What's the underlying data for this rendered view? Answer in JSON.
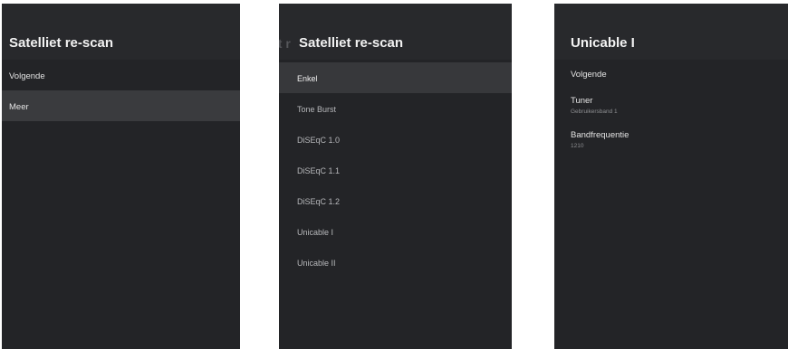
{
  "panel1": {
    "title": "Satelliet re-scan",
    "items": [
      {
        "label": "Volgende"
      },
      {
        "label": "Meer",
        "selected": true
      }
    ]
  },
  "panel2": {
    "ghost_title": "et r",
    "title": "Satelliet re-scan",
    "items": [
      {
        "label": "Enkel",
        "selected": true
      },
      {
        "label": "Tone Burst"
      },
      {
        "label": "DiSEqC 1.0"
      },
      {
        "label": "DiSEqC 1.1"
      },
      {
        "label": "DiSEqC 1.2"
      },
      {
        "label": "Unicable I"
      },
      {
        "label": "Unicable II"
      }
    ]
  },
  "panel3": {
    "title": "Unicable I",
    "items": [
      {
        "label": "Volgende"
      },
      {
        "label": "Tuner",
        "value": "Gebruikersband 1"
      },
      {
        "label": "Bandfrequentie",
        "value": "1210"
      }
    ]
  },
  "colors": {
    "panel_bg": "#232427",
    "header_bg": "#28292c",
    "selected_bg": "#3a3b3e"
  }
}
